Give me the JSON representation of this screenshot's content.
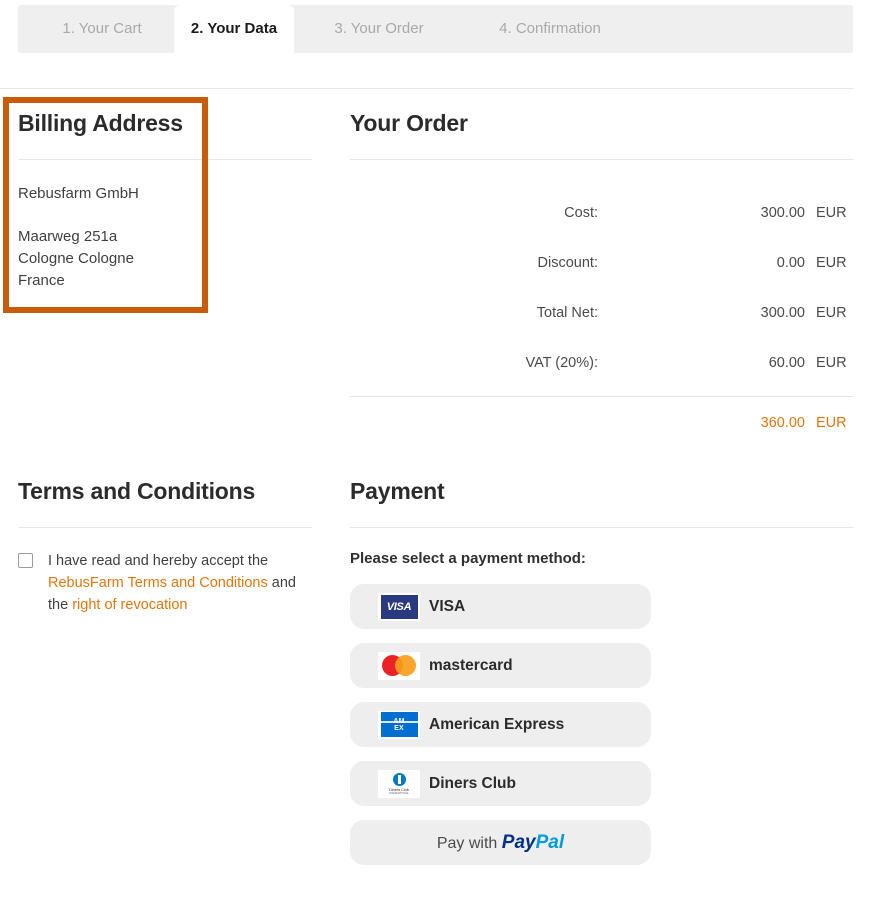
{
  "steps": {
    "tabs": [
      {
        "label": "1. Your Cart",
        "active": false
      },
      {
        "label": "2. Your Data",
        "active": true
      },
      {
        "label": "3. Your Order",
        "active": false
      },
      {
        "label": "4. Confirmation",
        "active": false
      }
    ]
  },
  "billing": {
    "title": "Billing Address",
    "company": "Rebusfarm GmbH",
    "street": "Maarweg 251a",
    "city": "Cologne Cologne",
    "country": "France",
    "highlight_color": "#c95c09"
  },
  "order": {
    "title": "Your Order",
    "rows": [
      {
        "label": "Cost:",
        "amount": "300.00",
        "currency": "EUR"
      },
      {
        "label": "Discount:",
        "amount": "0.00",
        "currency": "EUR"
      },
      {
        "label": "Total Net:",
        "amount": "300.00",
        "currency": "EUR"
      },
      {
        "label": "VAT (20%):",
        "amount": "60.00",
        "currency": "EUR"
      }
    ],
    "total": {
      "amount": "360.00",
      "currency": "EUR",
      "color": "#e2760d"
    }
  },
  "terms": {
    "title": "Terms and Conditions",
    "text_before": "I have read and hereby accept the",
    "link_terms": "RebusFarm Terms and Conditions",
    "text_middle": "and the",
    "link_revocation": "right of revocation",
    "accepted": false
  },
  "payment": {
    "title": "Payment",
    "prompt": "Please select a payment method:",
    "methods": [
      {
        "label": "VISA",
        "logo": "visa-logo"
      },
      {
        "label": "mastercard",
        "logo": "mastercard-logo"
      },
      {
        "label": "American Express",
        "logo": "amex-logo"
      },
      {
        "label": "Diners Club",
        "logo": "diners-club-logo"
      }
    ],
    "paypal": {
      "prefix": "Pay with",
      "brand_first": "Pay",
      "brand_second": "Pal"
    },
    "diners_logo_text": {
      "name": "Diners Club",
      "sub": "INTERNATIONAL"
    },
    "amex_logo_text": {
      "line1": "AM",
      "line2": "EX"
    },
    "visa_logo_text": "VISA"
  }
}
